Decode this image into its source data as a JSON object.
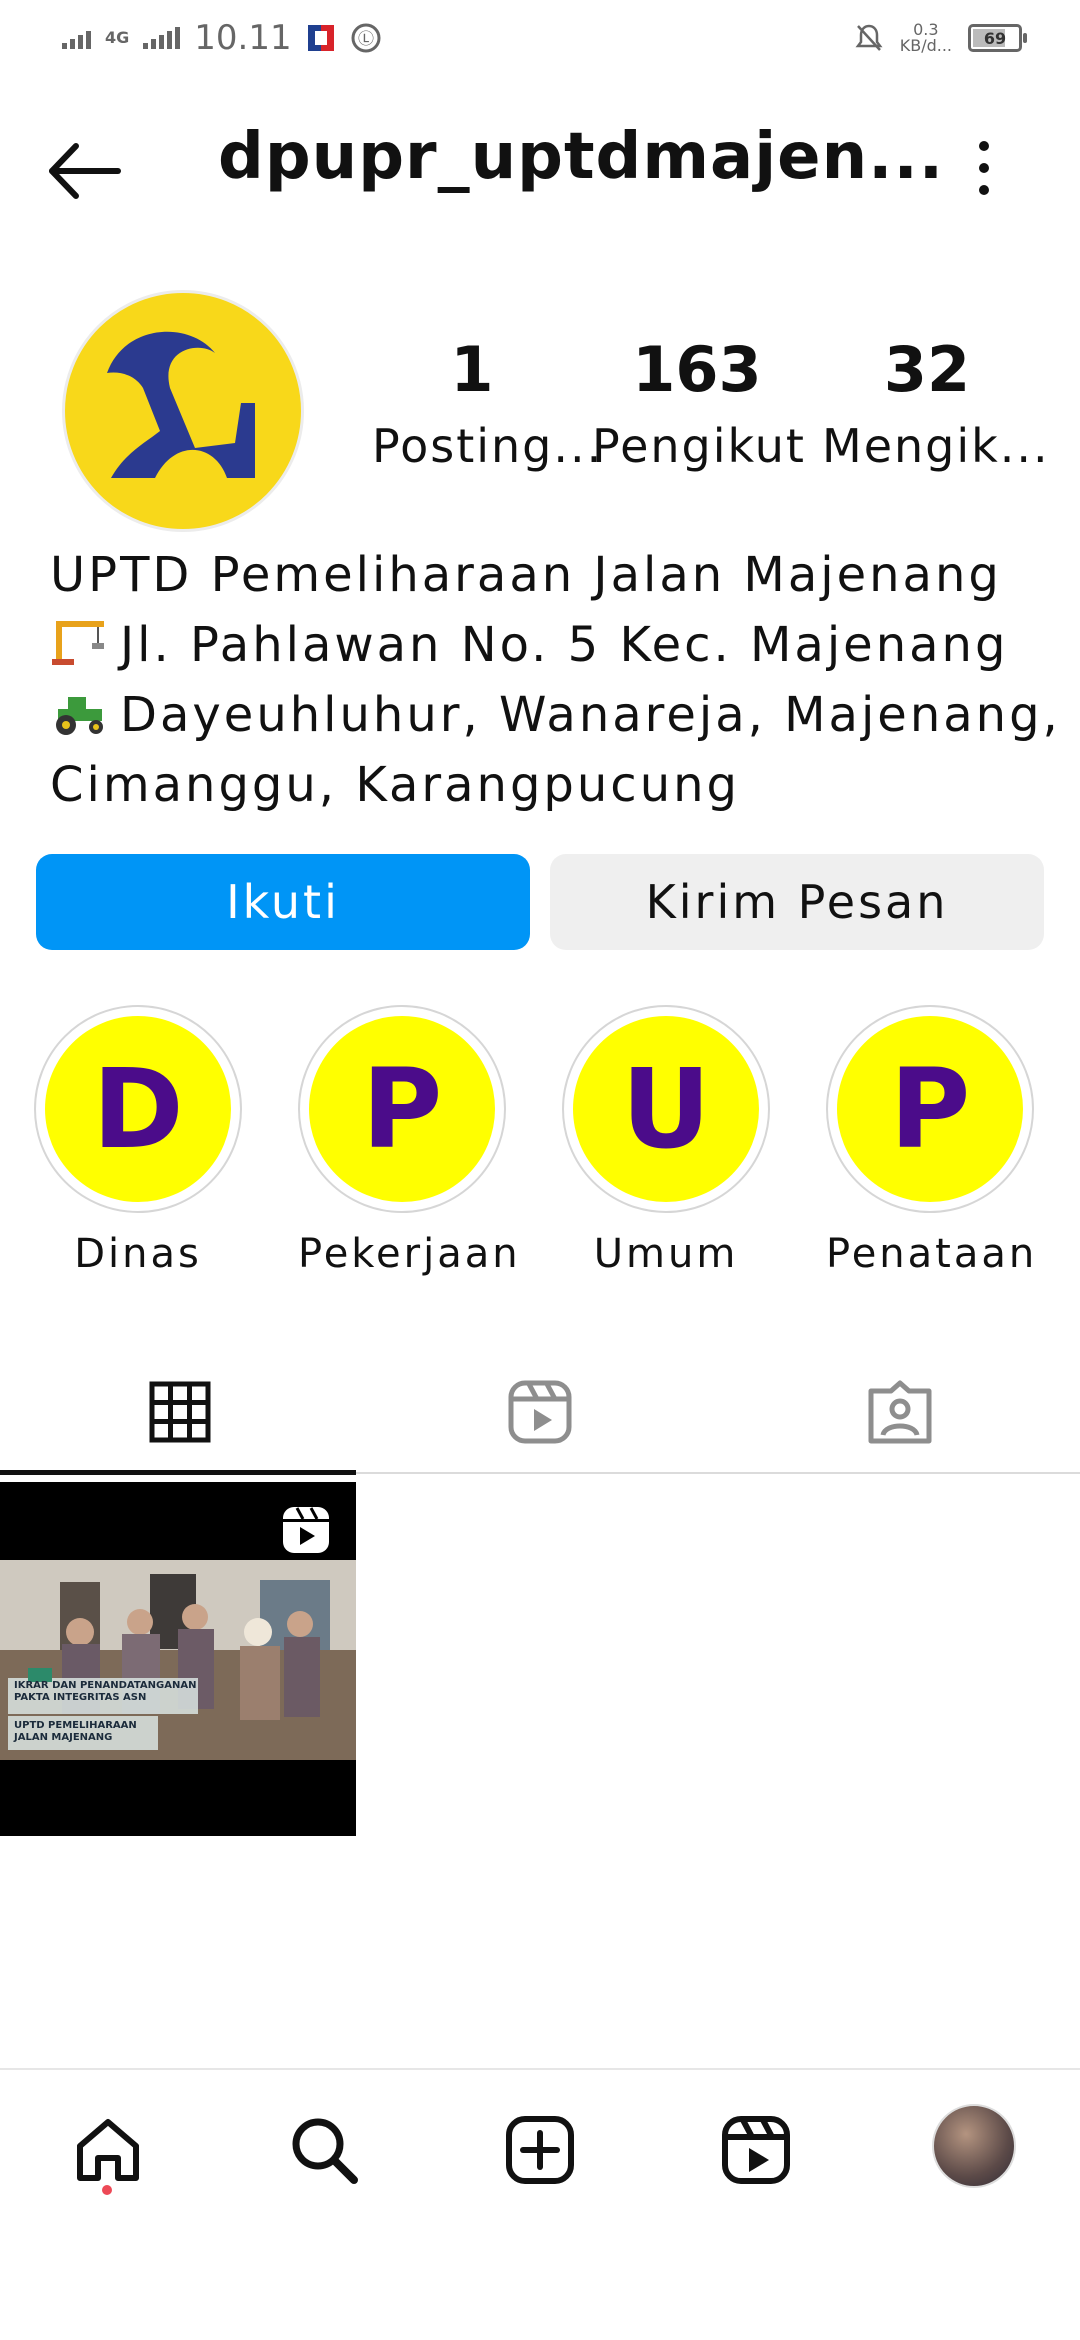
{
  "status_bar": {
    "network": "4G",
    "time": "10.11",
    "speed_value": "0.3",
    "speed_unit": "KB/d...",
    "battery": "69"
  },
  "header": {
    "username": "dpupr_uptdmajen..."
  },
  "profile": {
    "stats": [
      {
        "value": "1",
        "label": "Posting..."
      },
      {
        "value": "163",
        "label": "Pengikut"
      },
      {
        "value": "32",
        "label": "Mengik..."
      }
    ],
    "bio": {
      "line1": "UPTD Pemeliharaan Jalan Majenang",
      "line2": "Jl. Pahlawan No. 5 Kec. Majenang",
      "line3": "Dayeuhluhur, Wanareja, Majenang,",
      "line4": "Cimanggu, Karangpucung"
    }
  },
  "actions": {
    "follow": "Ikuti",
    "message": "Kirim Pesan"
  },
  "highlights": [
    {
      "letter": "D",
      "label": "Dinas"
    },
    {
      "letter": "P",
      "label": "Pekerjaan"
    },
    {
      "letter": "U",
      "label": "Umum"
    },
    {
      "letter": "P",
      "label": "Penataan"
    }
  ],
  "posts": [
    {
      "caption_line1": "IKRAR DAN PENANDATANGANAN",
      "caption_line2": "PAKTA INTEGRITAS ASN",
      "caption_line3": "UPTD PEMELIHARAAN",
      "caption_line4": "JALAN MAJENANG"
    }
  ],
  "colors": {
    "accent": "#0095f6",
    "highlight_fill": "#ffff00",
    "highlight_letter": "#4b0c8a",
    "avatar_bg": "#f8d81a",
    "logo": "#2b3a8f"
  }
}
